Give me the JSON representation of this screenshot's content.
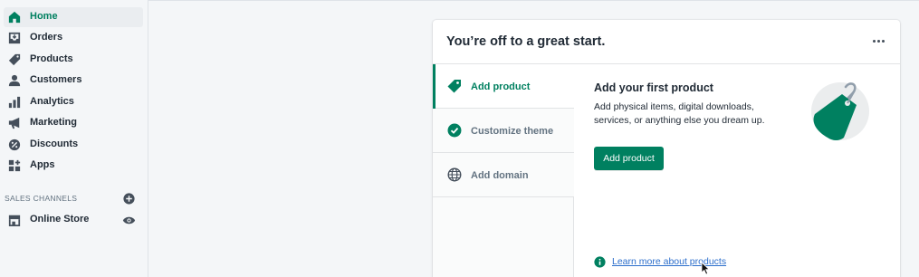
{
  "sidebar": {
    "items": [
      {
        "label": "Home",
        "icon": "home-icon",
        "active": true
      },
      {
        "label": "Orders",
        "icon": "orders-icon"
      },
      {
        "label": "Products",
        "icon": "tag-icon"
      },
      {
        "label": "Customers",
        "icon": "person-icon"
      },
      {
        "label": "Analytics",
        "icon": "bar-chart-icon"
      },
      {
        "label": "Marketing",
        "icon": "megaphone-icon"
      },
      {
        "label": "Discounts",
        "icon": "discount-icon"
      },
      {
        "label": "Apps",
        "icon": "apps-icon"
      }
    ],
    "sales_channels_label": "SALES CHANNELS",
    "online_store_label": "Online Store"
  },
  "card": {
    "title": "You’re off to a great start.",
    "tabs": [
      {
        "label": "Add product",
        "icon": "tag-icon",
        "active": true
      },
      {
        "label": "Customize theme",
        "icon": "check-circle-icon"
      },
      {
        "label": "Add domain",
        "icon": "globe-icon"
      }
    ],
    "panel": {
      "title": "Add your first product",
      "description": "Add physical items, digital downloads, services, or anything else you dream up.",
      "button_label": "Add product",
      "learn_more": "Learn more about products"
    }
  },
  "colors": {
    "accent": "#008060",
    "link": "#2c6ecb",
    "sidebar_bg": "#f4f6f8",
    "text": "#212b36",
    "muted": "#637381"
  }
}
